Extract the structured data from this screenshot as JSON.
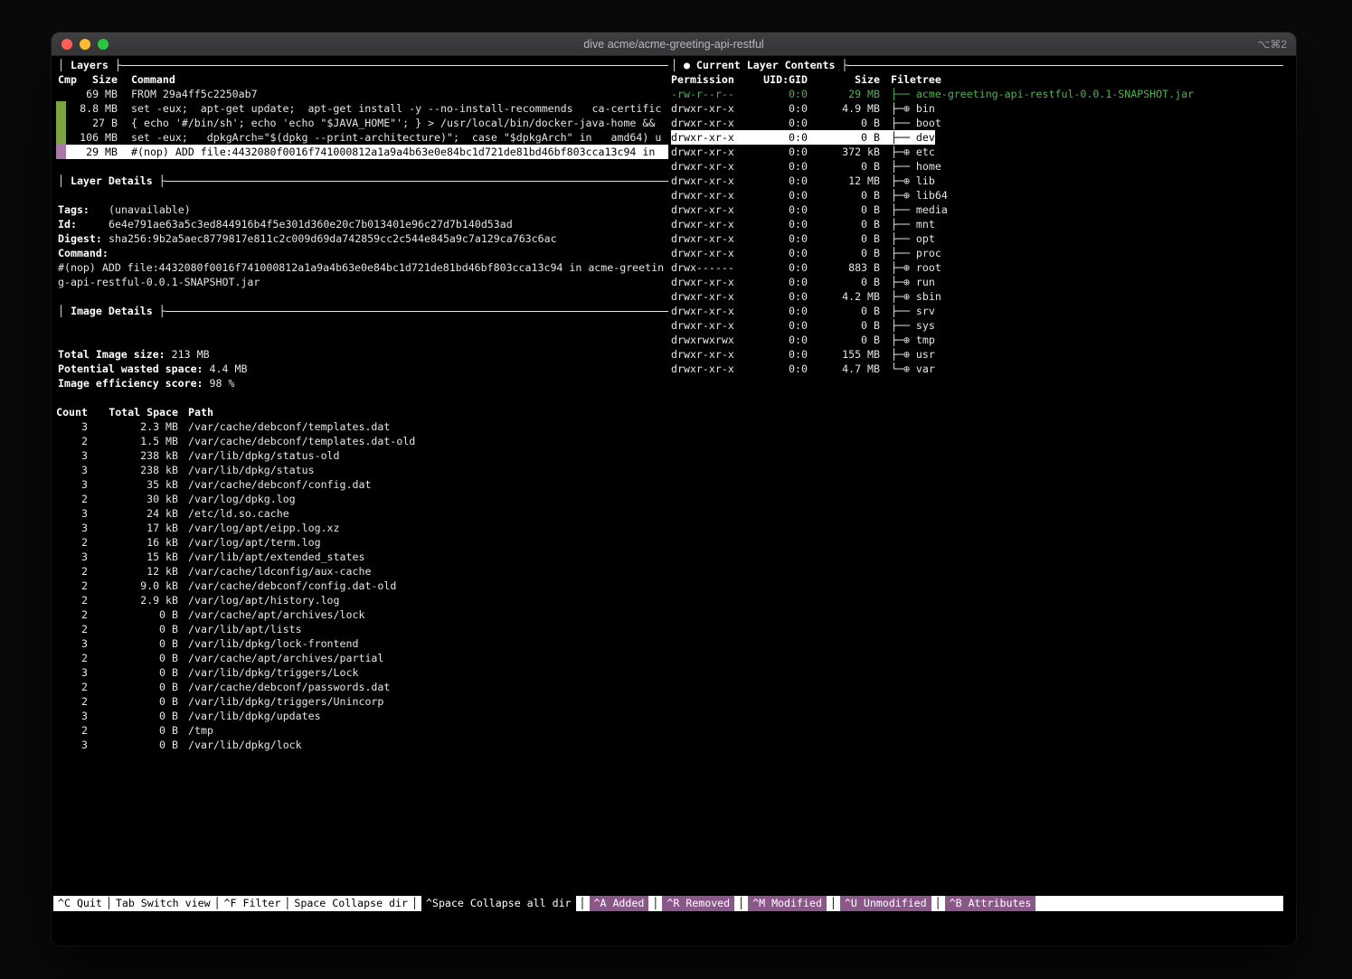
{
  "colors": {
    "green": "#4eb44e",
    "bar_green": "#7ba342",
    "purple_bar": "#a978a9",
    "purple_status": "#8b578b",
    "selection_bg": "#ffffff"
  },
  "chrome": {
    "pane_border_left": "│ ",
    "pane_border_join": " ├"
  },
  "window": {
    "title": "dive acme/acme-greeting-api-restful",
    "shortcut": "⌥⌘2"
  },
  "layers_pane": {
    "title": "Layers",
    "columns": {
      "cmp": "Cmp",
      "size": "Size",
      "command": "Command"
    },
    "rows": [
      {
        "size": "69 MB",
        "bar": "none",
        "selected": false,
        "command": "FROM 29a4ff5c2250ab7"
      },
      {
        "size": "8.8 MB",
        "bar": "green",
        "selected": false,
        "command": "set -eux;  apt-get update;  apt-get install -y --no-install-recommends   ca-certific"
      },
      {
        "size": "27 B",
        "bar": "green",
        "selected": false,
        "command": "{ echo '#/bin/sh'; echo 'echo \"$JAVA_HOME\"'; } > /usr/local/bin/docker-java-home &&"
      },
      {
        "size": "106 MB",
        "bar": "green",
        "selected": false,
        "command": "set -eux;   dpkgArch=\"$(dpkg --print-architecture)\";  case \"$dpkgArch\" in   amd64) u"
      },
      {
        "size": "29 MB",
        "bar": "purple",
        "selected": true,
        "command": "#(nop) ADD file:4432080f0016f741000812a1a9a4b63e0e84bc1d721de81bd46bf803cca13c94 in"
      }
    ]
  },
  "layer_details": {
    "title": "Layer Details",
    "tags_label": "Tags:",
    "tags": "(unavailable)",
    "id_label": "Id:",
    "id": "6e4e791ae63a5c3ed844916b4f5e301d360e20c7b013401e96c27d7b140d53ad",
    "digest_label": "Digest:",
    "digest": "sha256:9b2a5aec8779817e811c2c009d69da742859cc2c544e845a9c7a129ca763c6ac",
    "command_label": "Command:",
    "command_lines": [
      "#(nop) ADD file:4432080f0016f741000812a1a9a4b63e0e84bc1d721de81bd46bf803cca13c94 in acme-greetin",
      "g-api-restful-0.0.1-SNAPSHOT.jar"
    ]
  },
  "image_details": {
    "title": "Image Details",
    "rows": [
      {
        "label": "Total Image size:",
        "value": "213 MB"
      },
      {
        "label": "Potential wasted space:",
        "value": "4.4 MB"
      },
      {
        "label": "Image efficiency score:",
        "value": "98 %"
      }
    ],
    "table": {
      "columns": [
        "Count",
        "Total Space",
        "Path"
      ],
      "rows": [
        {
          "count": "3",
          "space": "2.3 MB",
          "path": "/var/cache/debconf/templates.dat"
        },
        {
          "count": "2",
          "space": "1.5 MB",
          "path": "/var/cache/debconf/templates.dat-old"
        },
        {
          "count": "3",
          "space": "238 kB",
          "path": "/var/lib/dpkg/status-old"
        },
        {
          "count": "3",
          "space": "238 kB",
          "path": "/var/lib/dpkg/status"
        },
        {
          "count": "3",
          "space": "35 kB",
          "path": "/var/cache/debconf/config.dat"
        },
        {
          "count": "2",
          "space": "30 kB",
          "path": "/var/log/dpkg.log"
        },
        {
          "count": "3",
          "space": "24 kB",
          "path": "/etc/ld.so.cache"
        },
        {
          "count": "3",
          "space": "17 kB",
          "path": "/var/log/apt/eipp.log.xz"
        },
        {
          "count": "2",
          "space": "16 kB",
          "path": "/var/log/apt/term.log"
        },
        {
          "count": "3",
          "space": "15 kB",
          "path": "/var/lib/apt/extended_states"
        },
        {
          "count": "2",
          "space": "12 kB",
          "path": "/var/cache/ldconfig/aux-cache"
        },
        {
          "count": "2",
          "space": "9.0 kB",
          "path": "/var/cache/debconf/config.dat-old"
        },
        {
          "count": "2",
          "space": "2.9 kB",
          "path": "/var/log/apt/history.log"
        },
        {
          "count": "2",
          "space": "0 B",
          "path": "/var/cache/apt/archives/lock"
        },
        {
          "count": "2",
          "space": "0 B",
          "path": "/var/lib/apt/lists"
        },
        {
          "count": "3",
          "space": "0 B",
          "path": "/var/lib/dpkg/lock-frontend"
        },
        {
          "count": "2",
          "space": "0 B",
          "path": "/var/cache/apt/archives/partial"
        },
        {
          "count": "3",
          "space": "0 B",
          "path": "/var/lib/dpkg/triggers/Lock"
        },
        {
          "count": "2",
          "space": "0 B",
          "path": "/var/cache/debconf/passwords.dat"
        },
        {
          "count": "2",
          "space": "0 B",
          "path": "/var/lib/dpkg/triggers/Unincorp"
        },
        {
          "count": "3",
          "space": "0 B",
          "path": "/var/lib/dpkg/updates"
        },
        {
          "count": "2",
          "space": "0 B",
          "path": "/tmp"
        },
        {
          "count": "3",
          "space": "0 B",
          "path": "/var/lib/dpkg/lock"
        }
      ]
    }
  },
  "filetree_pane": {
    "title": "● Current Layer Contents",
    "columns": {
      "permission": "Permission",
      "uid_gid": "UID:GID",
      "size": "Size",
      "filetree": "Filetree"
    },
    "rows": [
      {
        "permission": "-rw-r--r--",
        "uid_gid": "0:0",
        "size": "29 MB",
        "prefix": "├── ",
        "name": "acme-greeting-api-restful-0.0.1-SNAPSHOT.jar",
        "state": "green"
      },
      {
        "permission": "drwxr-xr-x",
        "uid_gid": "0:0",
        "size": "4.9 MB",
        "prefix": "├─⊕ ",
        "name": "bin"
      },
      {
        "permission": "drwxr-xr-x",
        "uid_gid": "0:0",
        "size": "0 B",
        "prefix": "├── ",
        "name": "boot"
      },
      {
        "permission": "drwxr-xr-x",
        "uid_gid": "0:0",
        "size": "0 B",
        "prefix": "├── ",
        "name": "dev",
        "state": "selected"
      },
      {
        "permission": "drwxr-xr-x",
        "uid_gid": "0:0",
        "size": "372 kB",
        "prefix": "├─⊕ ",
        "name": "etc"
      },
      {
        "permission": "drwxr-xr-x",
        "uid_gid": "0:0",
        "size": "0 B",
        "prefix": "├── ",
        "name": "home"
      },
      {
        "permission": "drwxr-xr-x",
        "uid_gid": "0:0",
        "size": "12 MB",
        "prefix": "├─⊕ ",
        "name": "lib"
      },
      {
        "permission": "drwxr-xr-x",
        "uid_gid": "0:0",
        "size": "0 B",
        "prefix": "├─⊕ ",
        "name": "lib64"
      },
      {
        "permission": "drwxr-xr-x",
        "uid_gid": "0:0",
        "size": "0 B",
        "prefix": "├── ",
        "name": "media"
      },
      {
        "permission": "drwxr-xr-x",
        "uid_gid": "0:0",
        "size": "0 B",
        "prefix": "├── ",
        "name": "mnt"
      },
      {
        "permission": "drwxr-xr-x",
        "uid_gid": "0:0",
        "size": "0 B",
        "prefix": "├── ",
        "name": "opt"
      },
      {
        "permission": "drwxr-xr-x",
        "uid_gid": "0:0",
        "size": "0 B",
        "prefix": "├── ",
        "name": "proc"
      },
      {
        "permission": "drwx------",
        "uid_gid": "0:0",
        "size": "883 B",
        "prefix": "├─⊕ ",
        "name": "root"
      },
      {
        "permission": "drwxr-xr-x",
        "uid_gid": "0:0",
        "size": "0 B",
        "prefix": "├─⊕ ",
        "name": "run"
      },
      {
        "permission": "drwxr-xr-x",
        "uid_gid": "0:0",
        "size": "4.2 MB",
        "prefix": "├─⊕ ",
        "name": "sbin"
      },
      {
        "permission": "drwxr-xr-x",
        "uid_gid": "0:0",
        "size": "0 B",
        "prefix": "├── ",
        "name": "srv"
      },
      {
        "permission": "drwxr-xr-x",
        "uid_gid": "0:0",
        "size": "0 B",
        "prefix": "├── ",
        "name": "sys"
      },
      {
        "permission": "drwxrwxrwx",
        "uid_gid": "0:0",
        "size": "0 B",
        "prefix": "├─⊕ ",
        "name": "tmp"
      },
      {
        "permission": "drwxr-xr-x",
        "uid_gid": "0:0",
        "size": "155 MB",
        "prefix": "├─⊕ ",
        "name": "usr"
      },
      {
        "permission": "drwxr-xr-x",
        "uid_gid": "0:0",
        "size": "4.7 MB",
        "prefix": "└─⊕ ",
        "name": "var"
      }
    ]
  },
  "statusbar": {
    "separator": "│",
    "items": [
      {
        "label": "^C Quit",
        "style": "plain"
      },
      {
        "label": "Tab Switch view",
        "style": "plain"
      },
      {
        "label": "^F Filter",
        "style": "plain"
      },
      {
        "label": "Space Collapse dir",
        "style": "plain"
      },
      {
        "label": "^Space Collapse all dir",
        "style": "inverted"
      },
      {
        "label": "^A Added",
        "style": "purple"
      },
      {
        "label": "^R Removed",
        "style": "purple"
      },
      {
        "label": "^M Modified",
        "style": "purple"
      },
      {
        "label": "^U Unmodified",
        "style": "purple"
      },
      {
        "label": "^B Attributes",
        "style": "purple"
      }
    ]
  }
}
